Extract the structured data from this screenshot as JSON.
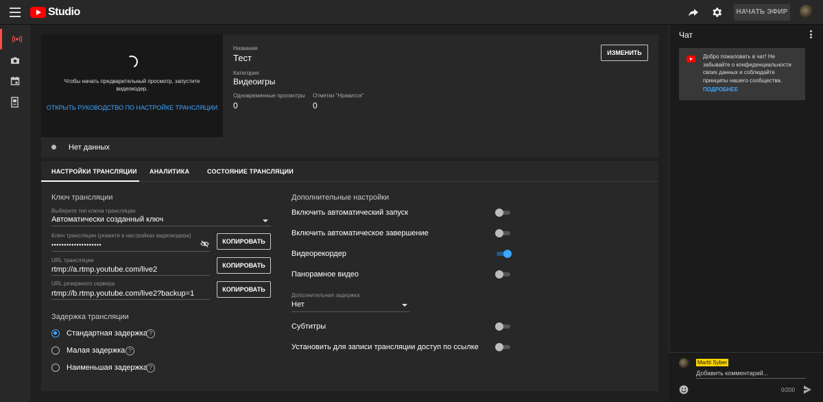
{
  "app": {
    "logo_text": "Studio",
    "go_live_label": "НАЧАТЬ ЭФИР"
  },
  "preview": {
    "message": "Чтобы начать предварительный просмотр, запустите видеокодер.",
    "guide_link": "ОТКРЫТЬ РУКОВОДСТВО ПО НАСТРОЙКЕ ТРАНСЛЯЦИИ"
  },
  "stream_info": {
    "title_label": "Название",
    "title_value": "Тест",
    "category_label": "Категория",
    "category_value": "Видеоигры",
    "viewers_label": "Одновременные просмотры",
    "viewers_value": "0",
    "likes_label": "Отметки \"Нравится\"",
    "likes_value": "0",
    "edit_label": "ИЗМЕНИТЬ"
  },
  "status": {
    "text": "Нет данных"
  },
  "tabs": [
    {
      "label": "НАСТРОЙКИ ТРАНСЛЯЦИИ",
      "active": true
    },
    {
      "label": "АНАЛИТИКА",
      "active": false
    },
    {
      "label": "СОСТОЯНИЕ ТРАНСЛЯЦИИ",
      "active": false
    }
  ],
  "stream_key": {
    "section_title": "Ключ трансляции",
    "type_label": "Выберите тип ключа трансляции",
    "type_value": "Автоматически созданный ключ",
    "key_label": "Ключ трансляции (укажите в настройках видеокодера)",
    "key_value": "••••••••••••••••••••",
    "url_label": "URL трансляции",
    "url_value": "rtmp://a.rtmp.youtube.com/live2",
    "backup_label": "URL резервного сервера",
    "backup_value": "rtmp://b.rtmp.youtube.com/live2?backup=1",
    "copy_label": "КОПИРОВАТЬ"
  },
  "latency": {
    "section_title": "Задержка трансляции",
    "options": [
      {
        "label": "Стандартная задержка",
        "checked": true
      },
      {
        "label": "Малая задержка",
        "checked": false
      },
      {
        "label": "Наименьшая задержка",
        "checked": false
      }
    ],
    "help_glyph": "?"
  },
  "additional": {
    "section_title": "Дополнительные настройки",
    "toggles": [
      {
        "label": "Включить автоматический запуск",
        "on": false
      },
      {
        "label": "Включить автоматическое завершение",
        "on": false
      },
      {
        "label": "Видеорекордер",
        "on": true
      },
      {
        "label": "Панорамное видео",
        "on": false
      }
    ],
    "delay_label": "Дополнительная задержка",
    "delay_value": "Нет",
    "toggles2": [
      {
        "label": "Субтитры",
        "on": false
      },
      {
        "label": "Установить для записи трансляции доступ по ссылке",
        "on": false
      }
    ]
  },
  "chat": {
    "title": "Чат",
    "welcome_text": "Добро пожаловать в чат! Не забывайте о конфиденциальности своих данных и соблюдайте принципы нашего сообщества.",
    "learn_more": "ПОДРОБНЕЕ",
    "user_name": "Martti Syber",
    "input_placeholder": "Добавить комментарий...",
    "char_count": "0/200"
  },
  "colors": {
    "accent": "#3ea6ff",
    "brand_red": "#ff0000",
    "live_red": "#ff4e45"
  }
}
